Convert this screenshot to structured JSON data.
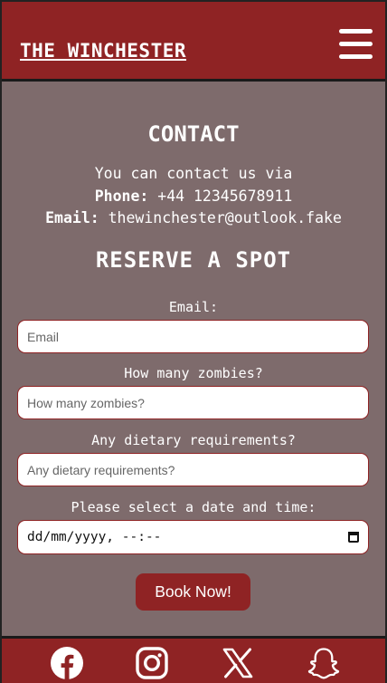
{
  "header": {
    "brand": "THE WINCHESTER",
    "menu_icon": "hamburger-menu-icon"
  },
  "contact": {
    "title": "CONTACT",
    "intro": "You can contact us via",
    "phone_label": "Phone:",
    "phone_value": "+44 12345678911",
    "email_label": "Email:",
    "email_value": "thewinchester@outlook.fake"
  },
  "reserve": {
    "title": "RESERVE A SPOT",
    "email": {
      "label": "Email:",
      "placeholder": "Email",
      "value": ""
    },
    "zombies": {
      "label": "How many zombies?",
      "placeholder": "How many zombies?",
      "value": ""
    },
    "dietary": {
      "label": "Any dietary requirements?",
      "placeholder": "Any dietary requirements?",
      "value": ""
    },
    "datetime": {
      "label": "Please select a date and time:",
      "display": "dd/mm/yyyy, --:--"
    },
    "submit": "Book Now!"
  },
  "footer": {
    "icons": [
      "facebook-icon",
      "instagram-icon",
      "x-icon",
      "snapchat-icon"
    ]
  },
  "colors": {
    "brand_red": "#8f2324",
    "panel": "#7e6b6c",
    "text": "#ffffff"
  }
}
